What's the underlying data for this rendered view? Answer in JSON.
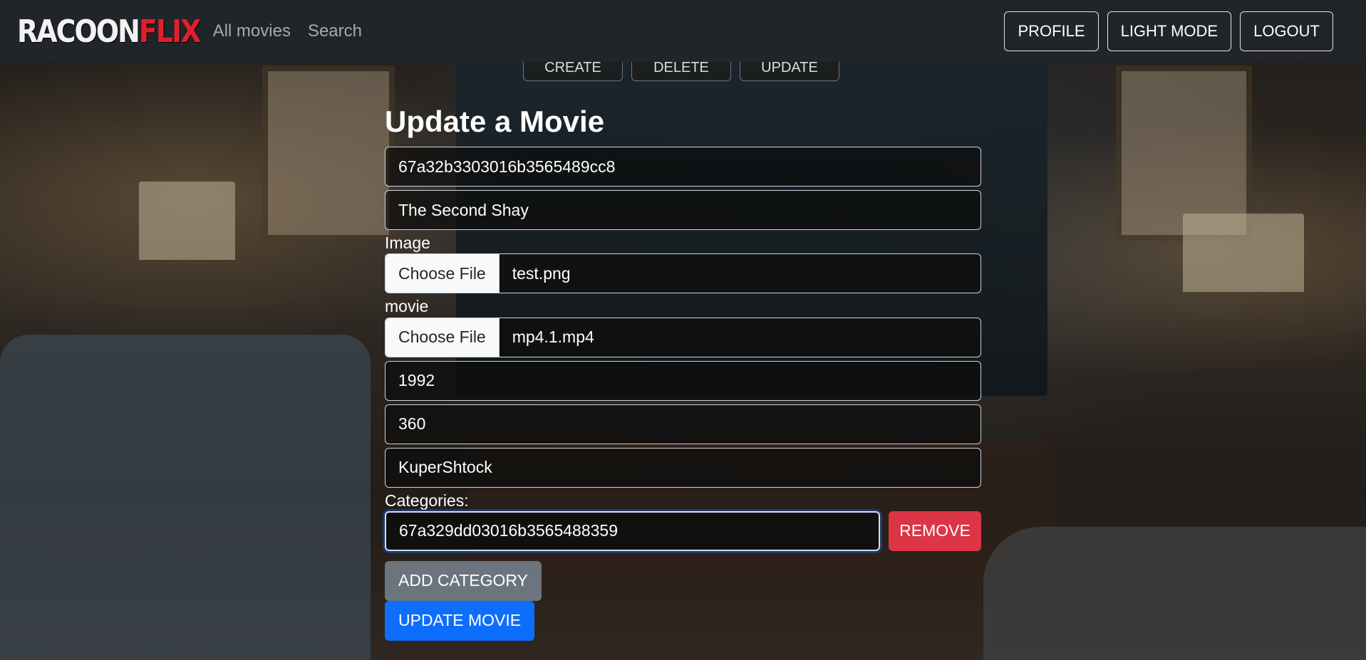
{
  "navbar": {
    "brand_part1": "RACOON",
    "brand_part2": "FLIX",
    "links": [
      "All movies",
      "Search"
    ],
    "buttons": [
      "PROFILE",
      "LIGHT MODE",
      "LOGOUT"
    ]
  },
  "admin_tabs": [
    "CREATE",
    "DELETE",
    "UPDATE"
  ],
  "form": {
    "title": "Update a Movie",
    "movie_id": "67a32b3303016b3565489cc8",
    "name": "The Second Shay",
    "image_label": "Image",
    "image_button": "Choose File",
    "image_file": "test.png",
    "movie_label": "movie",
    "movie_button": "Choose File",
    "movie_file": "mp4.1.mp4",
    "year": "1992",
    "duration": "360",
    "director": "KuperShtock",
    "categories_label": "Categories:",
    "category_value": "67a329dd03016b3565488359",
    "remove_label": "REMOVE",
    "add_category_label": "ADD CATEGORY",
    "update_label": "UPDATE MOVIE"
  },
  "colors": {
    "navbar_bg": "#212529",
    "brand_accent": "#e01f2d",
    "danger": "#dc3545",
    "secondary": "#6c757d",
    "primary": "#0d6efd"
  }
}
